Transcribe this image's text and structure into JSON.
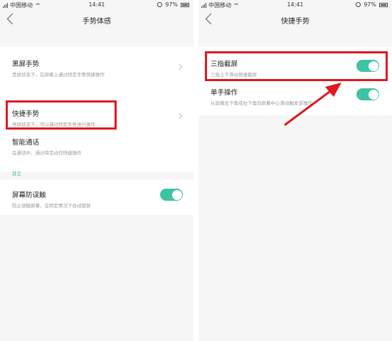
{
  "status_bar": {
    "carrier": "中国移动",
    "time": "14:41",
    "battery": "97%"
  },
  "left_screen": {
    "title": "手势体感",
    "items": [
      {
        "title": "黑屏手势",
        "subtitle": "黑屏状态下，在屏幕上通过特定手势快捷操作"
      },
      {
        "title": "快捷手势",
        "subtitle": "亮屏状态下，可以通过特定手势进行操作"
      },
      {
        "title": "智能通话",
        "subtitle": "在通话中，通过特定动作快捷操作"
      }
    ],
    "section_header": "其它",
    "toggle_item": {
      "title": "屏幕防误触",
      "subtitle": "防止误触屏幕，在特定情况下自动锁屏",
      "on": true
    }
  },
  "right_screen": {
    "title": "快捷手势",
    "items": [
      {
        "title": "三指截屏",
        "subtitle": "三指上下滑动快速截屏",
        "on": true
      },
      {
        "title": "单手操作",
        "subtitle": "从屏幕左下角或右下角向屏幕中心滑动触发该操作",
        "on": true
      }
    ]
  },
  "colors": {
    "toggle_on": "#3ec3a4",
    "highlight": "#e0181f",
    "section_header": "#44b79a"
  }
}
